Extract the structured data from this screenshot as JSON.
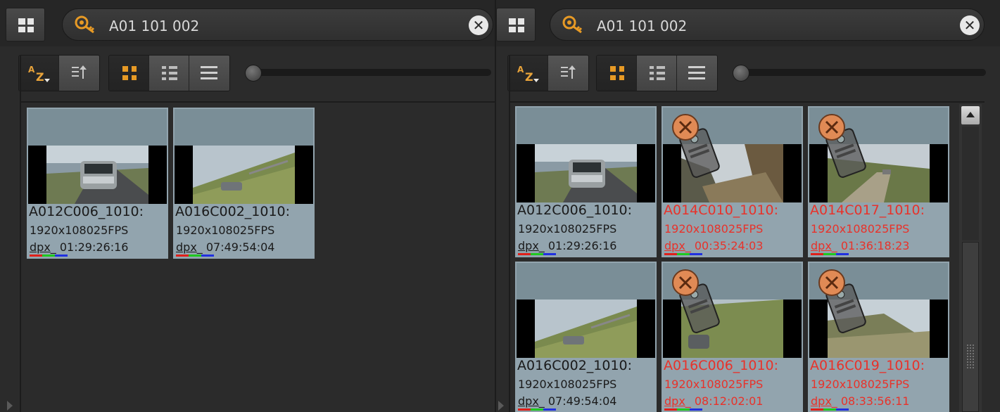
{
  "colors": {
    "panel_bg": "#2b2b2b",
    "accent_orange": "#e79a25",
    "offline_text": "#e8322a",
    "card_bg": "#92a4ae"
  },
  "left": {
    "search": {
      "value": "A01 101 002",
      "icon": "key-search-icon",
      "clear": "✕"
    },
    "sort": {
      "alpha_a": "A",
      "alpha_z": "Z"
    },
    "view_size_slider": 0.0,
    "clips": [
      {
        "name": "A012C006_1010:",
        "resolution": "1920x108025FPS",
        "format": "dpx",
        "timecode": "01:29:26:16",
        "offline": false
      },
      {
        "name": "A016C002_1010:",
        "resolution": "1920x108025FPS",
        "format": "dpx",
        "timecode": "07:49:54:04",
        "offline": false
      }
    ]
  },
  "right": {
    "search": {
      "value": "A01 101 002",
      "icon": "key-search-icon",
      "clear": "✕"
    },
    "sort": {
      "alpha_a": "A",
      "alpha_z": "Z"
    },
    "view_size_slider": 0.0,
    "clips": [
      {
        "name": "A012C006_1010:",
        "resolution": "1920x108025FPS",
        "format": "dpx",
        "timecode": "01:29:26:16",
        "offline": false
      },
      {
        "name": "A014C010_1010:",
        "resolution": "1920x108025FPS",
        "format": "dpx",
        "timecode": "00:35:24:03",
        "offline": true
      },
      {
        "name": "A014C017_1010:",
        "resolution": "1920x108025FPS",
        "format": "dpx",
        "timecode": "01:36:18:23",
        "offline": true
      },
      {
        "name": "A016C002_1010:",
        "resolution": "1920x108025FPS",
        "format": "dpx",
        "timecode": "07:49:54:04",
        "offline": false
      },
      {
        "name": "A016C006_1010:",
        "resolution": "1920x108025FPS",
        "format": "dpx",
        "timecode": "08:12:02:01",
        "offline": true
      },
      {
        "name": "A016C019_1010:",
        "resolution": "1920x108025FPS",
        "format": "dpx",
        "timecode": "08:33:56:11",
        "offline": true
      }
    ]
  }
}
